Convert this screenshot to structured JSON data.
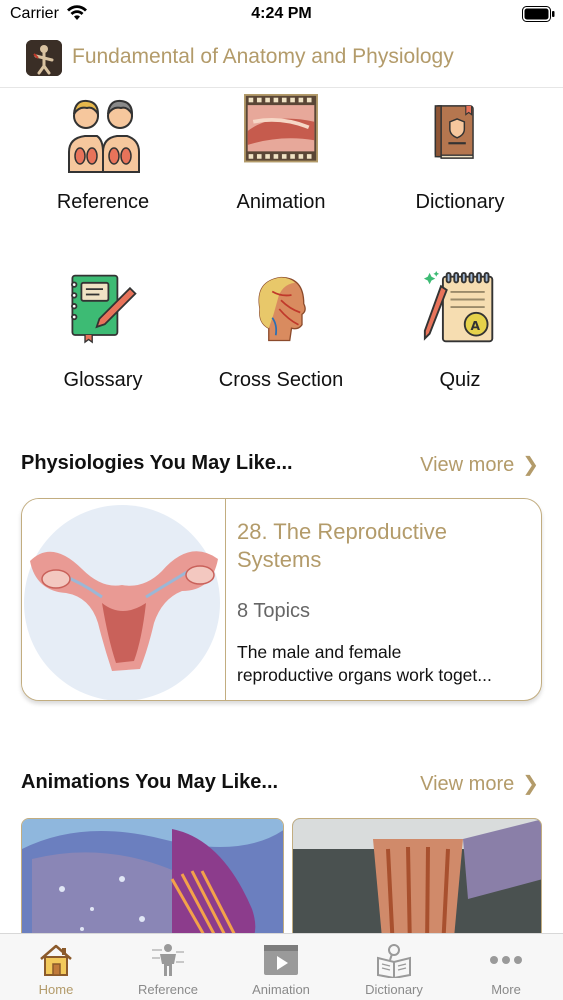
{
  "status_bar": {
    "carrier": "Carrier",
    "time": "4:24 PM"
  },
  "header": {
    "title": "Fundamental of Anatomy and Physiology",
    "logo_icon": "anatomy-figure-logo"
  },
  "tiles": [
    {
      "label": "Reference",
      "icon": "people-anatomy-icon"
    },
    {
      "label": "Animation",
      "icon": "film-strip-icon"
    },
    {
      "label": "Dictionary",
      "icon": "book-icon"
    },
    {
      "label": "Glossary",
      "icon": "notebook-pencil-icon"
    },
    {
      "label": "Cross Section",
      "icon": "head-cross-section-icon"
    },
    {
      "label": "Quiz",
      "icon": "quiz-notepad-icon"
    }
  ],
  "physiology_section": {
    "title": "Physiologies You May Like...",
    "view_more": "View more",
    "card": {
      "title_line1": "28. The Reproductive",
      "title_line2": "Systems",
      "topics": "8 Topics",
      "desc_line1": "The male and female",
      "desc_line2": "reproductive organs work toget..."
    }
  },
  "animation_section": {
    "title": "Animations You May Like...",
    "view_more": "View more"
  },
  "tab_bar": {
    "tabs": [
      {
        "label": "Home",
        "icon": "home-icon",
        "active": true
      },
      {
        "label": "Reference",
        "icon": "body-figure-icon",
        "active": false
      },
      {
        "label": "Animation",
        "icon": "play-icon",
        "active": false
      },
      {
        "label": "Dictionary",
        "icon": "book-search-icon",
        "active": false
      },
      {
        "label": "More",
        "icon": "more-dots-icon",
        "active": false
      }
    ]
  },
  "colors": {
    "accent": "#b39b6a",
    "border": "#c2ad80",
    "inactive_tab": "#8a8a8a"
  }
}
